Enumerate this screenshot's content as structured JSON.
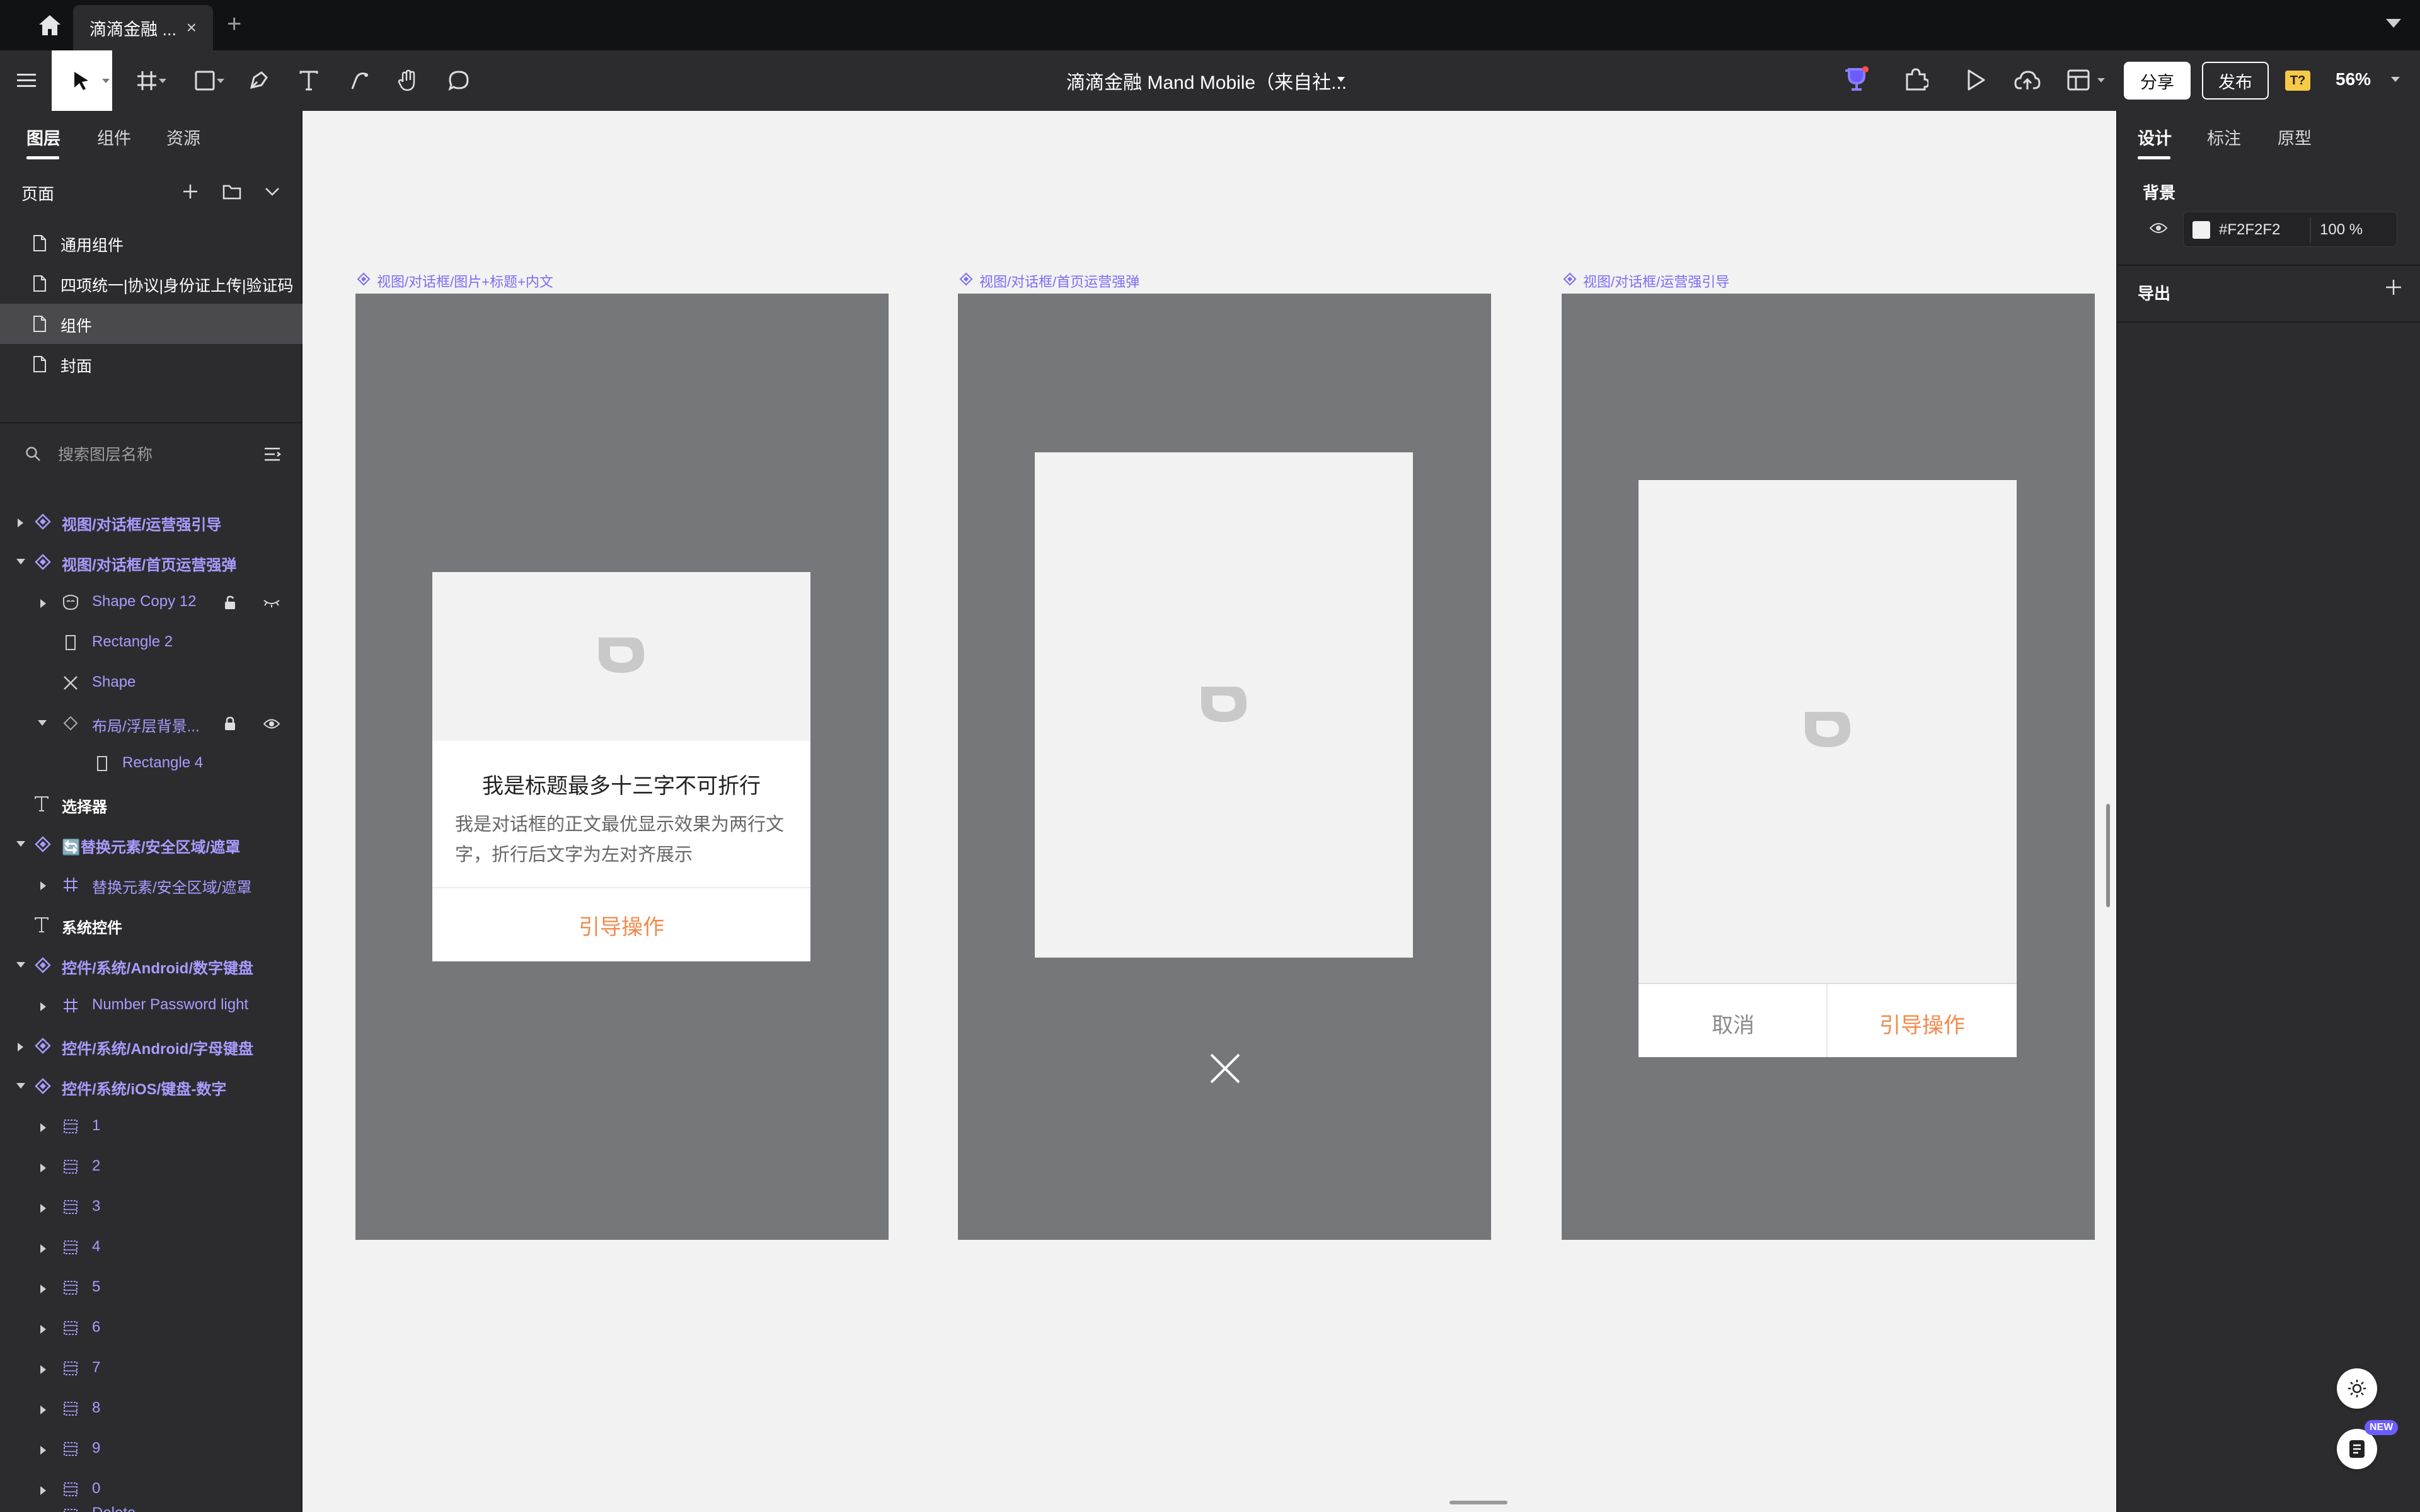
{
  "tabbar": {
    "doc_tab_label": "滴滴金融 ...",
    "close_glyph": "×",
    "new_tab_glyph": "+"
  },
  "toolbar": {
    "file_title": "滴滴金融 Mand Mobile（来自社...",
    "share_label": "分享",
    "publish_label": "发布",
    "ai_badge": "T?",
    "zoom": "56%"
  },
  "left_panel": {
    "tabs": [
      {
        "label": "图层",
        "active": true
      },
      {
        "label": "组件",
        "active": false
      },
      {
        "label": "资源",
        "active": false
      }
    ],
    "pages_label": "页面",
    "pages": [
      {
        "label": "通用组件",
        "selected": false
      },
      {
        "label": "四项统一|协议|身份证上传|验证码",
        "selected": false
      },
      {
        "label": "组件",
        "selected": true
      },
      {
        "label": "封面",
        "selected": false
      }
    ],
    "search_placeholder": "搜索图层名称",
    "layers": [
      {
        "label": "视图/对话框/运营强引导",
        "kind": "component",
        "expanded": false
      },
      {
        "label": "视图/对话框/首页运营强弹",
        "kind": "component",
        "expanded": true
      },
      {
        "label": "Shape Copy 12",
        "kind": "mask",
        "expanded": false
      },
      {
        "label": "Rectangle 2",
        "kind": "rect"
      },
      {
        "label": "Shape",
        "kind": "shape"
      },
      {
        "label": "布局/浮层背景...",
        "kind": "instance",
        "expanded": true
      },
      {
        "label": "Rectangle 4",
        "kind": "rect"
      },
      {
        "label": "选择器",
        "kind": "text"
      },
      {
        "label": "🔄替换元素/安全区域/遮罩",
        "kind": "component",
        "expanded": true
      },
      {
        "label": "替换元素/安全区域/遮罩",
        "kind": "frame",
        "expanded": false
      },
      {
        "label": "系统控件",
        "kind": "text"
      },
      {
        "label": "控件/系统/Android/数字键盘",
        "kind": "component",
        "expanded": true
      },
      {
        "label": "Number Password light",
        "kind": "frame",
        "expanded": false
      },
      {
        "label": "控件/系统/Android/字母键盘",
        "kind": "component",
        "expanded": false
      },
      {
        "label": "控件/系统/iOS/键盘-数字",
        "kind": "component",
        "expanded": true
      },
      {
        "label": "1",
        "kind": "group"
      },
      {
        "label": "2",
        "kind": "group"
      },
      {
        "label": "3",
        "kind": "group"
      },
      {
        "label": "4",
        "kind": "group"
      },
      {
        "label": "5",
        "kind": "group"
      },
      {
        "label": "6",
        "kind": "group"
      },
      {
        "label": "7",
        "kind": "group"
      },
      {
        "label": "8",
        "kind": "group"
      },
      {
        "label": "9",
        "kind": "group"
      },
      {
        "label": "0",
        "kind": "group"
      },
      {
        "label": "Delete",
        "kind": "group"
      }
    ]
  },
  "right_panel": {
    "tabs": [
      {
        "label": "设计",
        "active": true
      },
      {
        "label": "标注",
        "active": false
      },
      {
        "label": "原型",
        "active": false
      }
    ],
    "background_label": "背景",
    "background_hex": "#F2F2F2",
    "background_opacity": "100 %",
    "export_label": "导出"
  },
  "canvas": {
    "frames": [
      {
        "label": "视图/对话框/图片+标题+内文"
      },
      {
        "label": "视图/对话框/首页运营强弹"
      },
      {
        "label": "视图/对话框/运营强引导"
      }
    ],
    "dialog1": {
      "title": "我是标题最多十三字不可折行",
      "body": "我是对话框的正文最优显示效果为两行文字，折行后文字为左对齐展示",
      "action": "引导操作"
    },
    "dialog3": {
      "cancel": "取消",
      "action": "引导操作"
    }
  },
  "floating": {
    "new_badge": "NEW"
  },
  "colors": {
    "frame_gray": "#76777a",
    "accent_orange": "#f08a4b",
    "component_purple": "#a89cff",
    "canvas_bg": "#F2F2F2"
  }
}
